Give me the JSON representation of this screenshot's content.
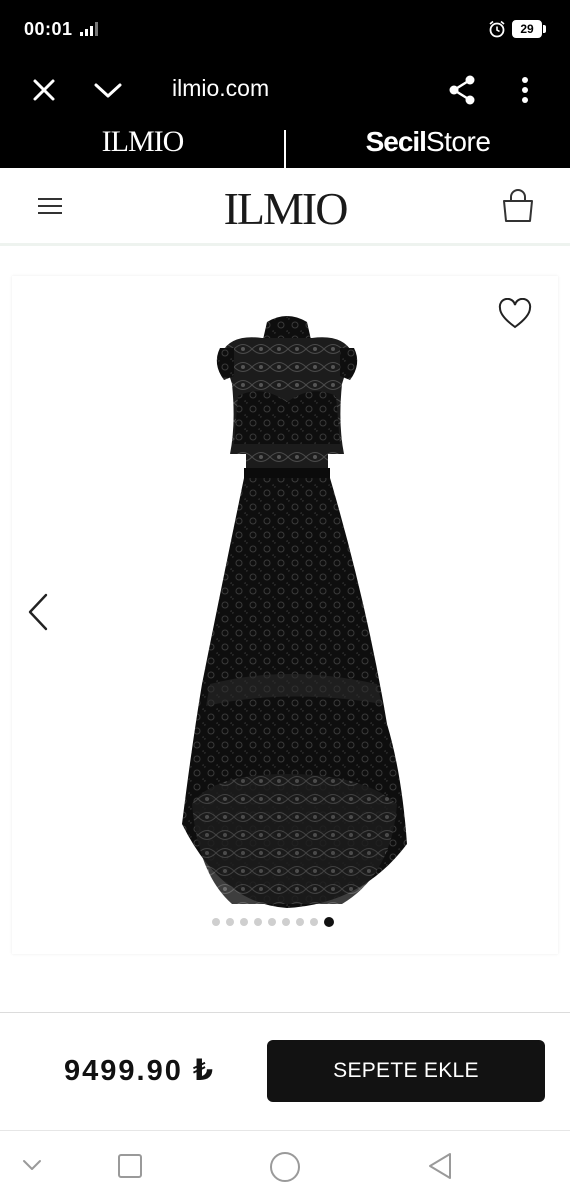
{
  "status_bar": {
    "time": "00:01",
    "battery": "29"
  },
  "browser": {
    "url": "ilmio.com"
  },
  "brand_switcher": {
    "left_brand": "ILMIO",
    "right_brand_bold": "Secil",
    "right_brand_light": "Store"
  },
  "header": {
    "logo": "ILMIO"
  },
  "gallery": {
    "image_count": 9,
    "active_index": 8
  },
  "cart": {
    "price": "9499.90 ₺",
    "add_label": "SEPETE EKLE"
  },
  "colors": {
    "accent": "#121212",
    "background": "#ffffff",
    "bar": "#000000"
  },
  "icons": [
    "close-icon",
    "chevron-down-icon",
    "share-icon",
    "more-vertical-icon",
    "menu-icon",
    "shopping-bag-icon",
    "heart-icon",
    "chevron-left-icon",
    "alarm-icon",
    "signal-icon",
    "battery-icon"
  ]
}
